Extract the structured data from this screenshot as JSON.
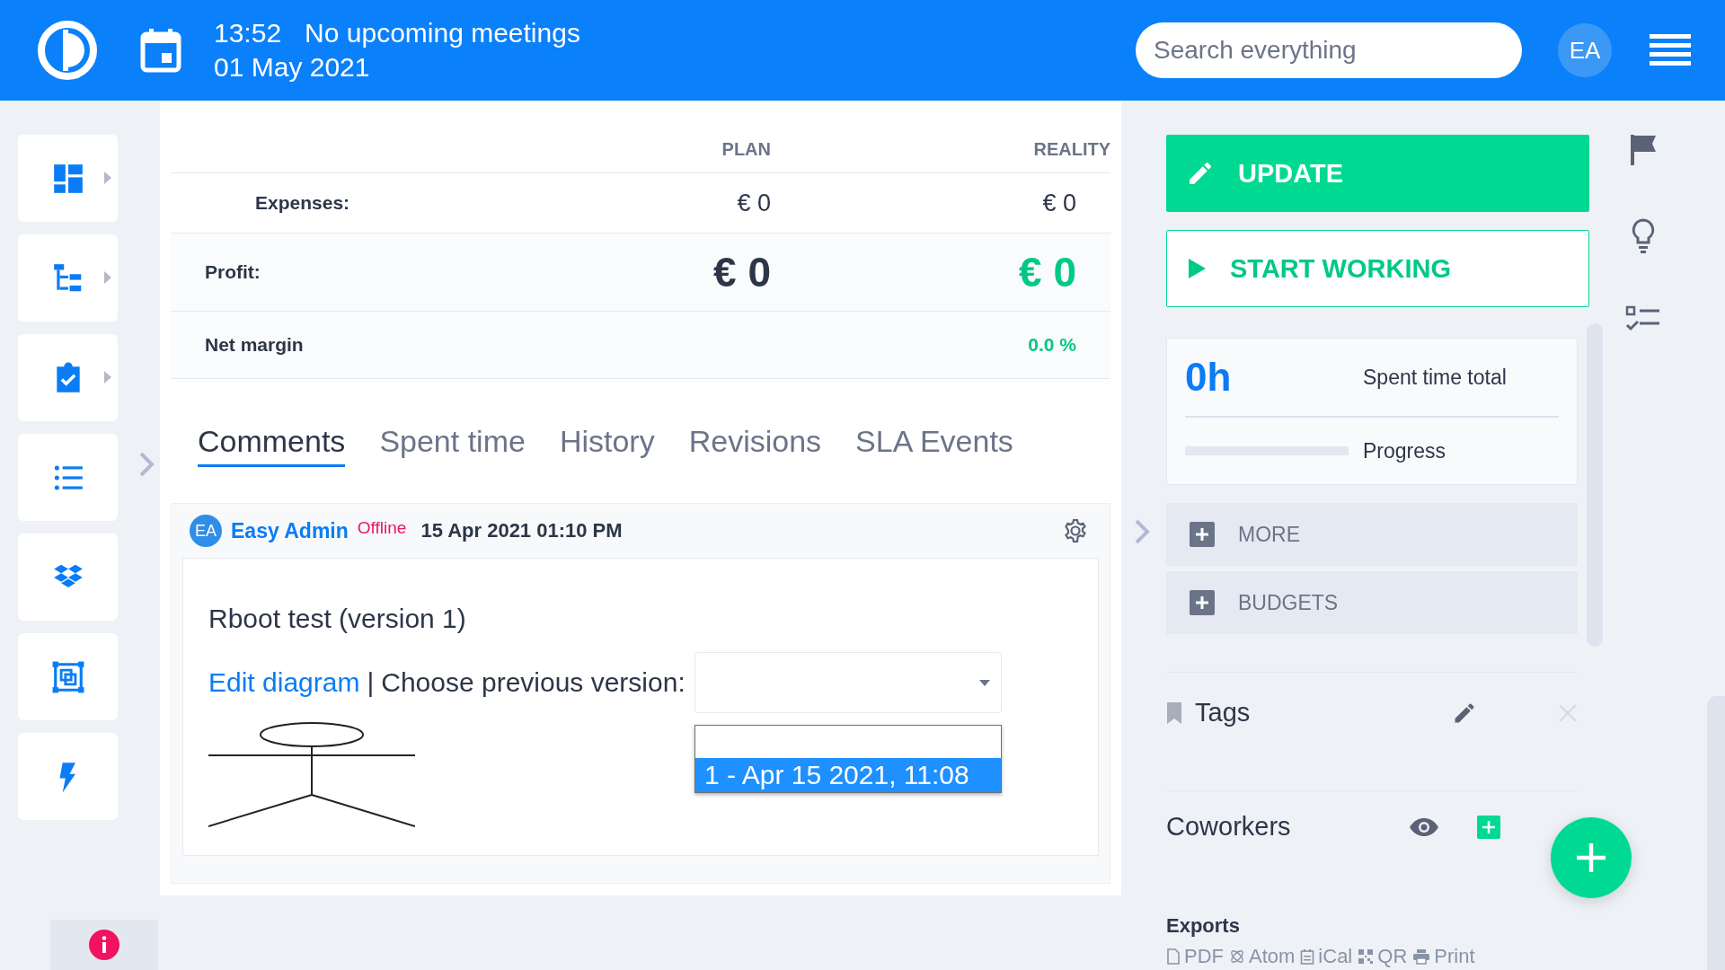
{
  "header": {
    "time": "13:52",
    "meetings": "No upcoming meetings",
    "date": "01 May 2021",
    "search": {
      "placeholder": "Search everything"
    },
    "avatar": "EA"
  },
  "sidebar": {
    "items": [
      {
        "kind": "dashboard",
        "submenu": true
      },
      {
        "kind": "tree",
        "submenu": true
      },
      {
        "kind": "clipboard",
        "submenu": true
      },
      {
        "kind": "list",
        "submenu": false
      },
      {
        "kind": "dropbox",
        "submenu": false
      },
      {
        "kind": "diagram",
        "submenu": false
      },
      {
        "kind": "bolt",
        "submenu": false
      }
    ]
  },
  "finance": {
    "columns": [
      "PLAN",
      "REALITY"
    ],
    "rows": [
      {
        "kind": "sub",
        "label": "Expenses:",
        "plan": "€ 0",
        "reality": "€ 0"
      },
      {
        "kind": "total",
        "label": "Profit:",
        "plan": "€ 0",
        "reality": "€ 0"
      },
      {
        "kind": "margin",
        "label": "Net margin",
        "reality": "0.0 %"
      }
    ]
  },
  "tabs": [
    {
      "label": "Comments",
      "selected": true
    },
    {
      "label": "Spent time",
      "selected": false
    },
    {
      "label": "History",
      "selected": false
    },
    {
      "label": "Revisions",
      "selected": false
    },
    {
      "label": "SLA Events",
      "selected": false
    }
  ],
  "comment": {
    "avatar": "EA",
    "author": "Easy Admin",
    "status": "Offline",
    "date": "15 Apr 2021 01:10 PM",
    "title": "Rboot test (version 1)",
    "link": "Edit diagram",
    "separator": "|",
    "prompt": "Choose previous version:",
    "options": [
      {
        "label": "1 - Apr 15 2021, 11:08",
        "selected": true
      }
    ]
  },
  "actions": [
    {
      "kind": "update",
      "label": "UPDATE"
    },
    {
      "kind": "start",
      "label": "START WORKING"
    }
  ],
  "time_card": {
    "value": "0h",
    "value_label": "Spent time total",
    "progress": {
      "level": 0,
      "label": "Progress"
    }
  },
  "sections": [
    {
      "label": "MORE",
      "expanded": false
    },
    {
      "label": "BUDGETS",
      "expanded": false
    }
  ],
  "widgets": [
    {
      "kind": "tags",
      "title": "Tags"
    },
    {
      "kind": "coworkers",
      "title": "Coworkers"
    }
  ],
  "exports": {
    "title": "Exports",
    "links": [
      {
        "kind": "pdf",
        "label": "PDF"
      },
      {
        "kind": "atom",
        "label": "Atom"
      },
      {
        "kind": "ical",
        "label": "iCal"
      },
      {
        "kind": "qr",
        "label": "QR"
      },
      {
        "kind": "print",
        "label": "Print"
      }
    ]
  }
}
